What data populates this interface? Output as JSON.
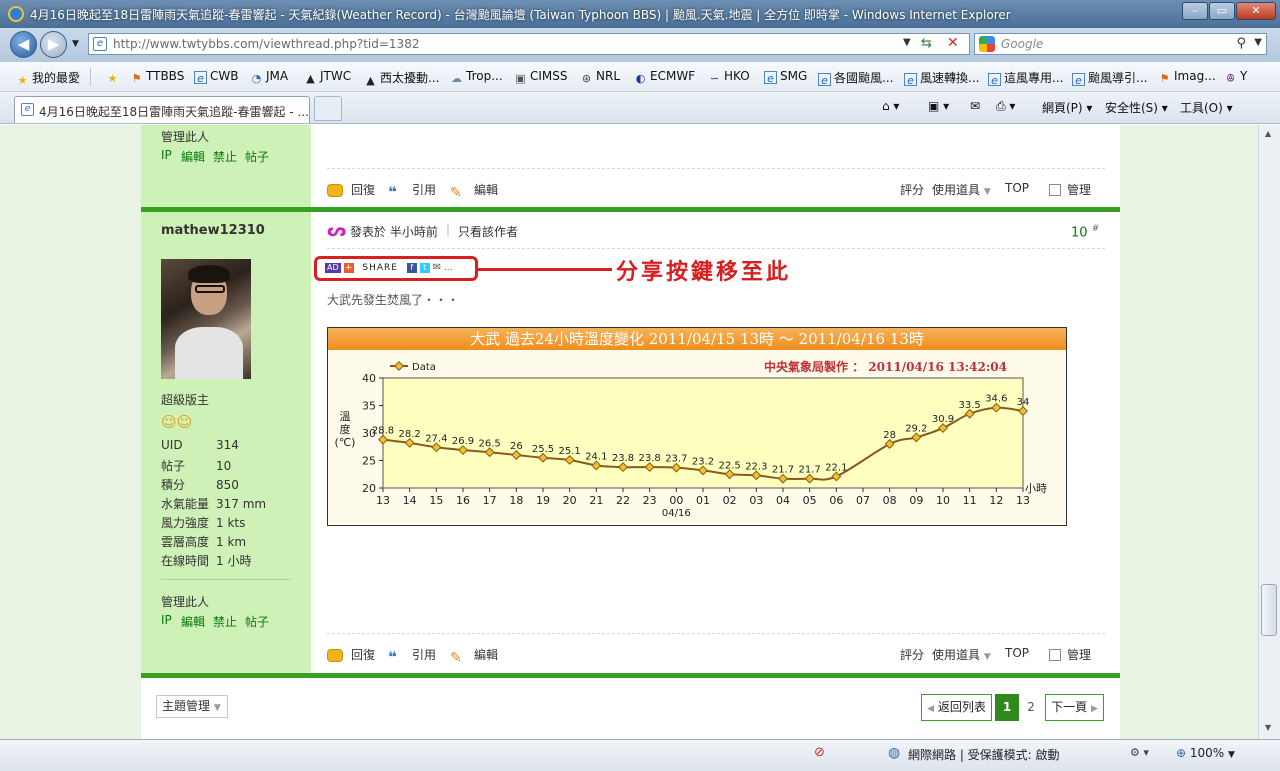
{
  "window": {
    "title": "4月16日晚起至18日雷陣雨天氣追蹤-春雷響起 - 天氣紀錄(Weather Record) - 台灣颱風論壇 (Taiwan Typhoon BBS) | 颱風.天氣.地震 | 全方位 即時掌 - Windows Internet Explorer",
    "minimize": "–",
    "restore": "▭",
    "close": "✕"
  },
  "nav": {
    "back": "◀",
    "forward": "▶",
    "url": "http://www.twtybbs.com/viewthread.php?tid=1382",
    "search_placeholder": "Google"
  },
  "favorites": [
    {
      "label": "我的最愛",
      "icon": "★"
    },
    {
      "label": "TTBBS",
      "icon": "⚑"
    },
    {
      "label": "CWB",
      "icon": "e"
    },
    {
      "label": "JMA",
      "icon": "◔"
    },
    {
      "label": "JTWC",
      "icon": "▲"
    },
    {
      "label": "西太擾動...",
      "icon": "▲"
    },
    {
      "label": "Trop...",
      "icon": "☁"
    },
    {
      "label": "CIMSS",
      "icon": "▣"
    },
    {
      "label": "NRL",
      "icon": "⊛"
    },
    {
      "label": "ECMWF",
      "icon": "◐"
    },
    {
      "label": "HKO",
      "icon": "∽"
    },
    {
      "label": "SMG",
      "icon": "e"
    },
    {
      "label": "各國颱風...",
      "icon": "e"
    },
    {
      "label": "風速轉換...",
      "icon": "e"
    },
    {
      "label": "這風專用...",
      "icon": "e"
    },
    {
      "label": "颱風導引...",
      "icon": "e"
    },
    {
      "label": "Imag...",
      "icon": "⚑"
    },
    {
      "label": "Y",
      "icon": "ꔮ"
    }
  ],
  "tab": {
    "label": "4月16日晚起至18日雷陣雨天氣追蹤-春雷響起 - ..."
  },
  "commandbar": {
    "page": "網頁(P)",
    "safety": "安全性(S)",
    "tools": "工具(O)"
  },
  "post_prev": {
    "manage": "管理此人",
    "links": [
      "IP",
      "編輯",
      "禁止",
      "帖子"
    ],
    "reply": "回復",
    "quote": "引用",
    "edit": "編輯",
    "rate": "評分",
    "use_tool": "使用道具",
    "top": "TOP",
    "admin": "管理"
  },
  "post": {
    "author": "mathew12310",
    "group": "超級版主",
    "stats": [
      {
        "label": "UID",
        "value": "314"
      },
      {
        "label": "帖子",
        "value": "10"
      },
      {
        "label": "積分",
        "value": "850"
      },
      {
        "label": "水氣能量",
        "value": "317 mm"
      },
      {
        "label": "風力強度",
        "value": "1 kts"
      },
      {
        "label": "雲層高度",
        "value": "1 km"
      },
      {
        "label": "在線時間",
        "value": "1 小時"
      }
    ],
    "manage": "管理此人",
    "links": [
      "IP",
      "編輯",
      "禁止",
      "帖子"
    ],
    "posted": "發表於 半小時前",
    "author_only": "只看該作者",
    "floor": "10",
    "floor_mark": "#",
    "share_ad": "AD",
    "share_label": "SHARE",
    "share_more": "...",
    "annotation": "分享按鍵移至此",
    "body": "大武先發生焚風了・・・",
    "reply": "回復",
    "quote": "引用",
    "edit": "編輯",
    "rate": "評分",
    "use_tool": "使用道具",
    "top": "TOP",
    "admin": "管理"
  },
  "chart_data": {
    "type": "line",
    "title": "大武  過去24小時溫度變化  2011/04/15  13時  ～  2011/04/16  13時",
    "credit": "中央氣象局製作 ： 2011/04/16  13:42:04",
    "legend": "Data",
    "legend_position": "top-left",
    "ylabel": "溫度(℃)",
    "xunit": "小時",
    "ylim": [
      20,
      40
    ],
    "yticks": [
      20,
      25,
      30,
      35,
      40
    ],
    "grid": false,
    "date_label": "04/16",
    "categories": [
      "13",
      "14",
      "15",
      "16",
      "17",
      "18",
      "19",
      "20",
      "21",
      "22",
      "23",
      "00",
      "01",
      "02",
      "03",
      "04",
      "05",
      "06",
      "07",
      "08",
      "09",
      "10",
      "11",
      "12",
      "13"
    ],
    "values": [
      28.8,
      28.2,
      27.4,
      26.9,
      26.5,
      26,
      25.5,
      25.1,
      24.1,
      23.8,
      23.8,
      23.7,
      23.2,
      22.5,
      22.3,
      21.7,
      21.7,
      22.1,
      null,
      28,
      29.2,
      30.9,
      33.5,
      34.6,
      34
    ],
    "labels": [
      "28.8",
      "28.2",
      "27.4",
      "26.9",
      "26.5",
      "26",
      "25.5",
      "25.1",
      "24.1",
      "23.8",
      "23.8",
      "23.7",
      "23.2",
      "22.5",
      "22.3",
      "21.7",
      "21.7",
      "22.1",
      "",
      "28",
      "29.2",
      "30.9",
      "33.5",
      "34.6",
      "34"
    ],
    "colors": {
      "line": "#8a5a1a",
      "marker": "#f2c02a",
      "plot_bg": "#ffffc0",
      "title_bg": "#f08e1d",
      "credit": "#c0303a"
    }
  },
  "footer": {
    "thread_admin": "主題管理",
    "back_list": "返回列表",
    "pages": [
      "1",
      "2"
    ],
    "next": "下一頁"
  },
  "status": {
    "zone": "網際網路 | 受保護模式: 啟動",
    "zoom": "100%"
  }
}
